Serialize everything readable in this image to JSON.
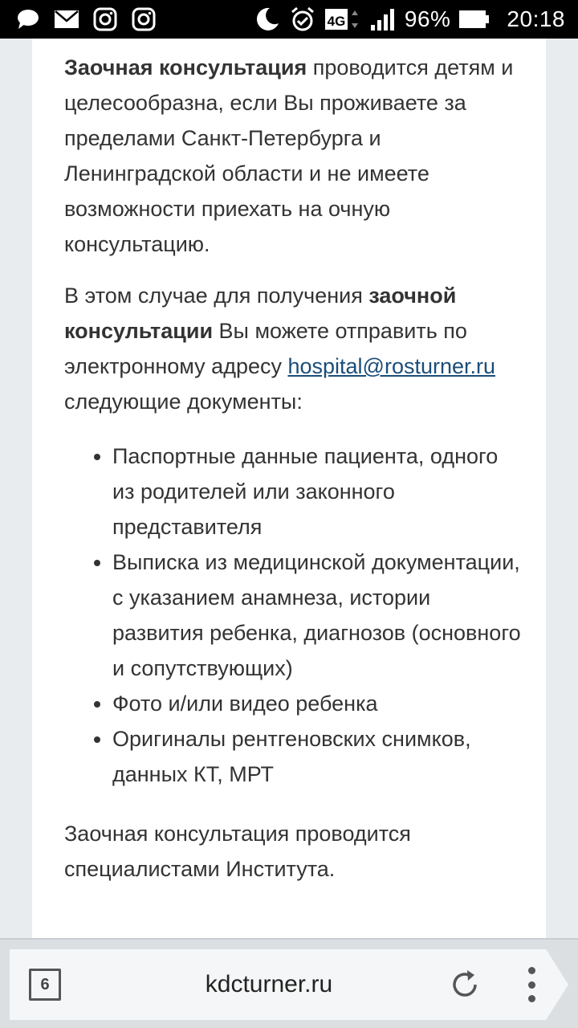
{
  "statusbar": {
    "battery_text": "96%",
    "network_type": "4G",
    "time": "20:18",
    "icons": [
      "message-icon",
      "mail-icon",
      "instagram-icon",
      "instagram-icon",
      "moon-icon",
      "alarm-icon",
      "network-4g-icon",
      "signal-icon",
      "battery-icon"
    ]
  },
  "article": {
    "p1_bold": "Заочная консультация",
    "p1_rest": " проводится детям и целесообразна, если Вы проживаете за пределами Санкт-Петербурга и Ленинградской области и не имеете возможности приехать на очную консультацию.",
    "p2_start": "В этом случае для получения ",
    "p2_bold": "заочной консультации",
    "p2_mid": " Вы можете отправить по электронному адресу ",
    "p2_email": "hospital@rosturner.ru",
    "p2_end": " следующие документы:",
    "list": [
      "Паспортные данные пациента, одного из родителей или законного представителя",
      "Выписка из медицинской документации, с указанием анамнеза, истории развития ребенка, диагнозов (основного и сопутствующих)",
      "Фото и/или видео ребенка",
      "Оригиналы рентгеновских снимков, данных КТ, МРТ"
    ],
    "p3": "Заочная консультация проводится специалистами Института."
  },
  "browser": {
    "tab_count": "6",
    "url": "kdcturner.ru"
  },
  "colors": {
    "text": "#333333",
    "link": "#1a4d7a",
    "background": "#e9ecef",
    "card": "#ffffff"
  }
}
